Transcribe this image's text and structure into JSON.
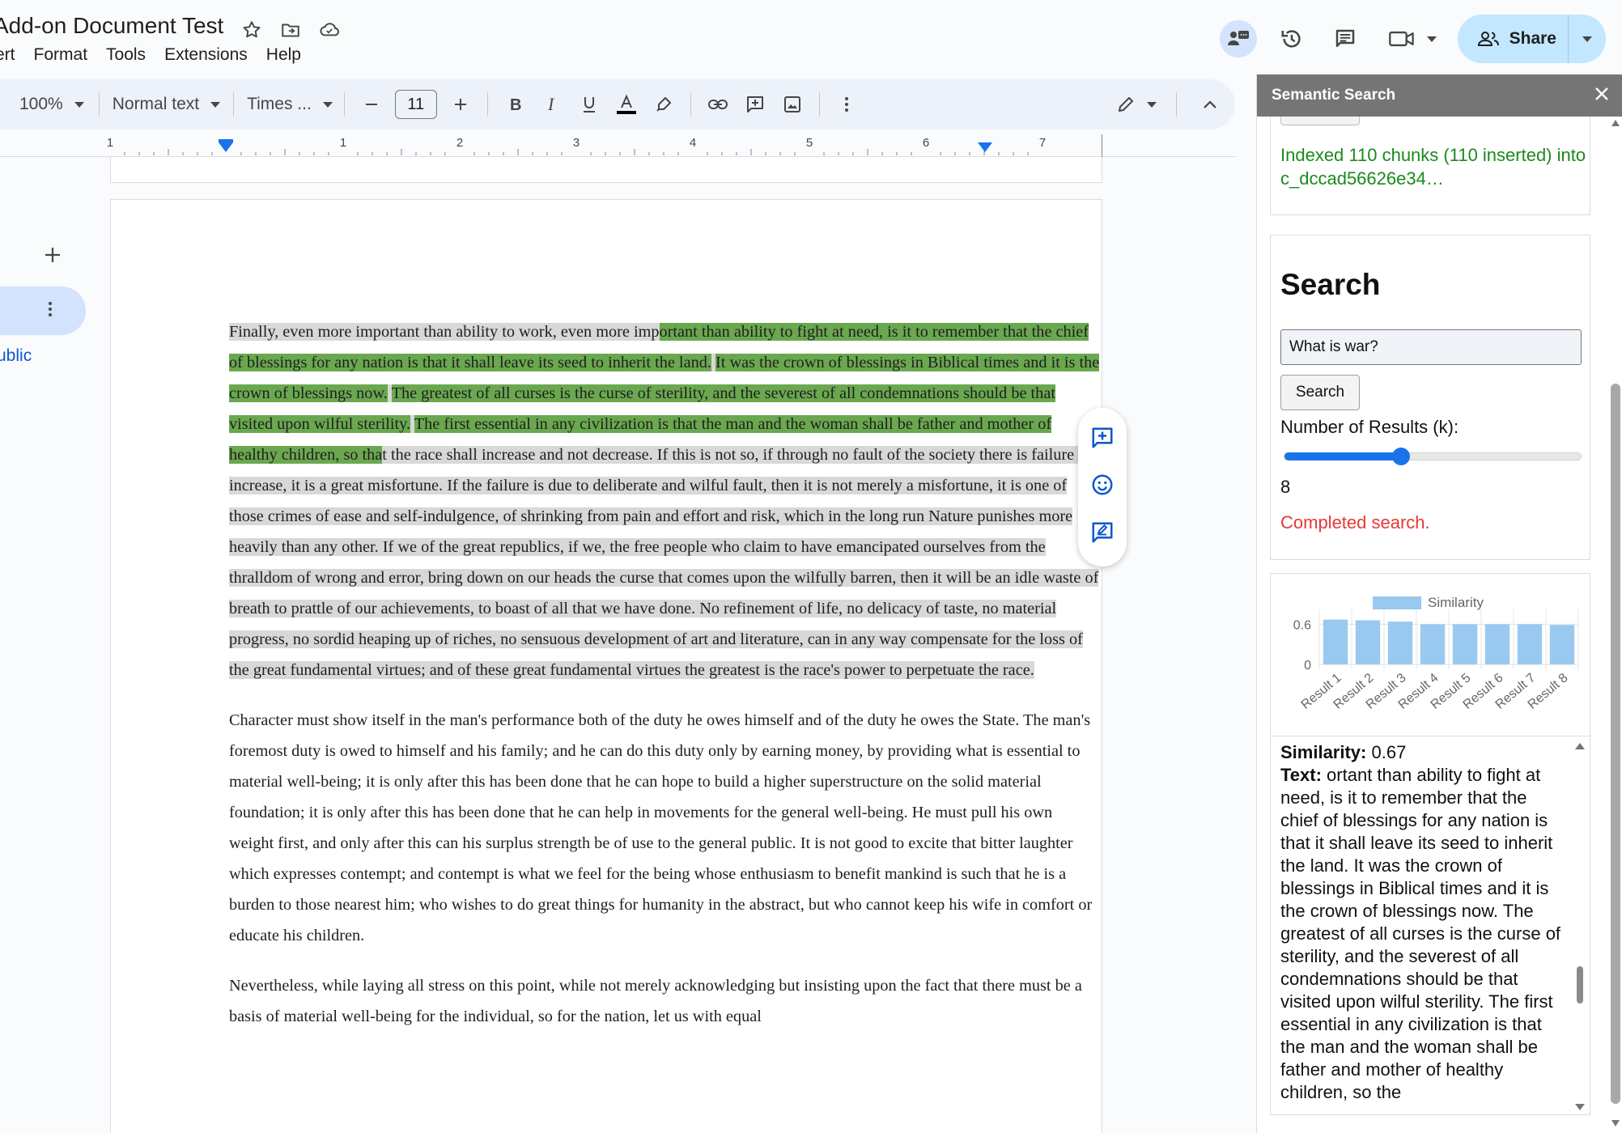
{
  "header": {
    "doc_title": "Add-on Document Test",
    "menus": [
      "ert",
      "Format",
      "Tools",
      "Extensions",
      "Help"
    ],
    "share_label": "Share"
  },
  "toolbar": {
    "zoom": "100%",
    "style": "Normal text",
    "font": "Times ...",
    "font_size": "11"
  },
  "ruler": {
    "labels": [
      "1",
      "1",
      "2",
      "3",
      "4",
      "5",
      "6",
      "7"
    ]
  },
  "left_pane": {
    "public_label": "ublic"
  },
  "document": {
    "para1": {
      "seg_a": "Finally, even more important than ability to work, even more imp",
      "seg_b": "ortant than ability to fight at need, is it to remember that the chief of blessings for any nation is that it shall leave its seed to inherit the land.",
      "seg_c": " ",
      "seg_d": "It was the crown of blessings in Biblical times and it is the crown of blessings now.",
      "seg_e": " ",
      "seg_f": "The greatest of all curses is the curse of sterility, and the severest of all condemnations should be that visited upon wilful sterility.",
      "seg_g": " ",
      "seg_h": "The first essential in any civilization is that the man and the woman shall be father and mother of healthy children, so tha",
      "seg_i": "t the race shall increase and not decrease. If this is not so, if through no fault of the society there is failure to increase, it is a great misfortune. If the failure is due to deliberate and wilful fault, then it is not merely a misfortune, it is one of those crimes of ease and self-indulgence, of shrinking from pain and effort and risk, which in the long run Nature punishes more heavily than any other. If we of the great republics, if we, the free people who claim to have emancipated ourselves from the thralldom of wrong and error, bring down on our heads the curse that comes upon the wilfully barren, then it will be an idle waste of breath to prattle of our achievements, to boast of all that we have done. No refinement of life, no delicacy of taste, no material progress, no sordid heaping up of riches, no sensuous development of art and literature, can in any way compensate for the loss of the great fundamental virtues; and of these great fundamental virtues the greatest is the race's power to perpetuate the race."
    },
    "para2": "Character must show itself in the man's performance both of the duty he owes himself and of the duty he owes the State. The man's foremost duty is owed to himself and his family; and he can do this duty only by earning money, by providing what is essential to material well-being; it is only after this has been done that he can hope to build a higher superstructure on the solid material foundation; it is only after this has been done that he can help in movements for the general well-being. He must pull his own weight first, and only after this can his surplus strength be of use to the general public. It is not good to excite that bitter laughter which expresses contempt; and contempt is what we feel for the being whose enthusiasm to benefit mankind is such that he is a burden to those nearest him; who wishes to do great things for humanity in the abstract, but who cannot keep his wife in comfort or educate his children.",
    "para3": "Nevertheless, while laying all stress on this point, while not merely acknowledging but insisting upon the fact that there must be a basis of material well-being for the individual, so for the nation, let us with equal"
  },
  "panel": {
    "title": "Semantic Search",
    "indexed_msg": "Indexed 110 chunks (110 inserted) into c_dccad56626e34…",
    "search_heading": "Search",
    "query": "What is war?",
    "search_button": "Search",
    "k_label": "Number of Results (k):",
    "k_value": "8",
    "k_fraction": 0.39,
    "status": "Completed search.",
    "result": {
      "sim_label": "Similarity:",
      "sim_value": " 0.67",
      "text_label": "Text:",
      "text_value": " ortant than ability to fight at need, is it to remember that the chief of blessings for any nation is that it shall leave its seed to inherit the land. It was the crown of blessings in Biblical times and it is the crown of blessings now. The greatest of all curses is the curse of sterility, and the severest of all condemnations should be that visited upon wilful sterility. The first essential in any civilization is that the man and the woman shall be father and mother of healthy children, so the"
    }
  },
  "chart_data": {
    "type": "bar",
    "categories": [
      "Result 1",
      "Result 2",
      "Result 3",
      "Result 4",
      "Result 5",
      "Result 6",
      "Result 7",
      "Result 8"
    ],
    "series": [
      {
        "name": "Similarity",
        "values": [
          0.67,
          0.66,
          0.64,
          0.6,
          0.6,
          0.6,
          0.6,
          0.59
        ]
      }
    ],
    "yticks": [
      "0.6",
      "0"
    ],
    "ylim": [
      0,
      0.75
    ],
    "legend": "top",
    "bar_color": "#99c9f0"
  },
  "colors": {
    "highlight": "#6aa84f",
    "selection": "#d8d8d8",
    "accent": "#1a73e8",
    "share_bg": "#c2e7ff",
    "status_red": "#e53935",
    "indexed_green": "#1b8a1b"
  }
}
